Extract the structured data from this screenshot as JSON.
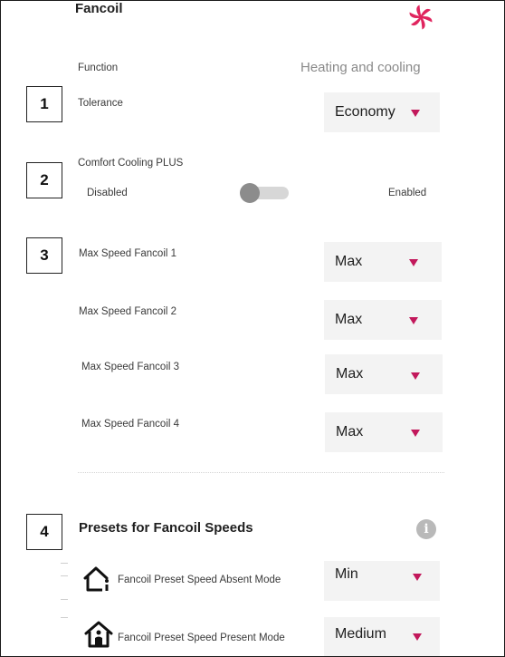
{
  "header": {
    "title": "Fancoil",
    "logo_icon": "fan-logo-icon",
    "brand_color": "#e0245e"
  },
  "function": {
    "label": "Function",
    "value": "Heating and cooling"
  },
  "tolerance": {
    "badge": "1",
    "label": "Tolerance",
    "value": "Economy"
  },
  "comfort_cooling": {
    "badge": "2",
    "label": "Comfort Cooling PLUS",
    "left_label": "Disabled",
    "right_label": "Enabled",
    "state": "Disabled"
  },
  "max_speed": {
    "badge": "3",
    "items": [
      {
        "label": "Max Speed Fancoil 1",
        "value": "Max"
      },
      {
        "label": "Max Speed Fancoil 2",
        "value": "Max"
      },
      {
        "label": "Max Speed Fancoil 3",
        "value": "Max"
      },
      {
        "label": "Max Speed Fancoil 4",
        "value": "Max"
      }
    ]
  },
  "presets": {
    "badge": "4",
    "title": "Presets for Fancoil Speeds",
    "info_icon": "info-icon",
    "info_glyph": "i",
    "items": [
      {
        "icon": "home-absent-icon",
        "label": "Fancoil Preset Speed Absent Mode",
        "value": "Min"
      },
      {
        "icon": "home-present-icon",
        "label": "Fancoil Preset Speed Present Mode",
        "value": "Medium"
      }
    ]
  },
  "colors": {
    "accent": "#c2185b",
    "select_bg": "#f3f3f3",
    "muted_text": "#8a8a8a"
  }
}
